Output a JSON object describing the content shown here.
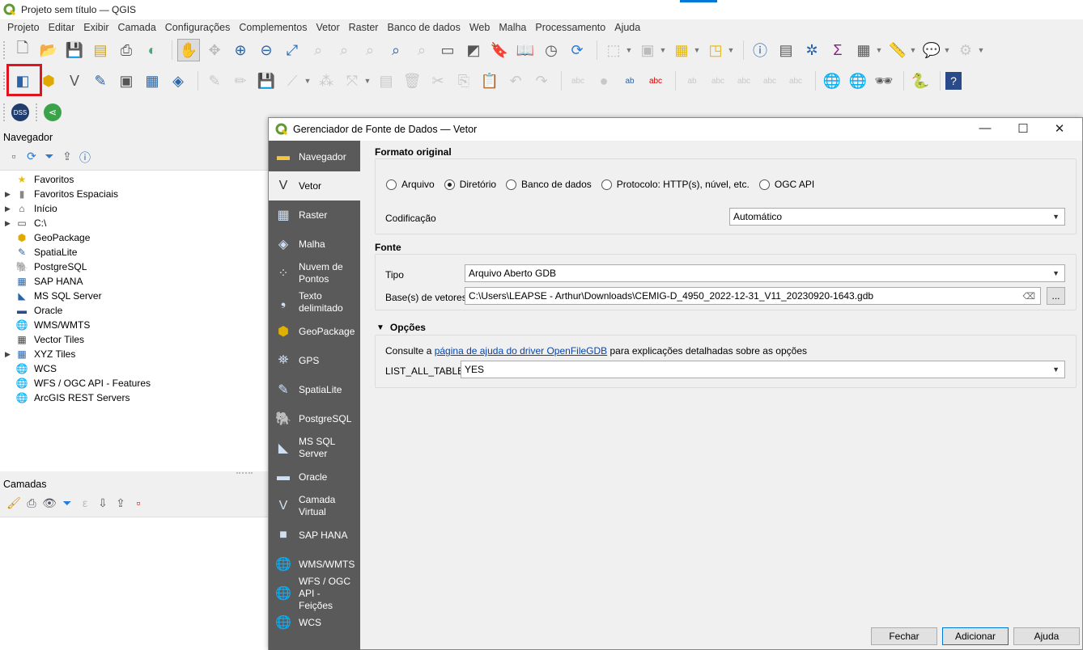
{
  "window": {
    "title": "Projeto sem título — QGIS"
  },
  "menu": [
    "Projeto",
    "Editar",
    "Exibir",
    "Camada",
    "Configurações",
    "Complementos",
    "Vetor",
    "Raster",
    "Banco de dados",
    "Web",
    "Malha",
    "Processamento",
    "Ajuda"
  ],
  "toolbar_row1_icons": [
    "new-project-icon",
    "open-project-icon",
    "save-project-icon",
    "new-print-layout-icon",
    "layout-manager-icon",
    "style-manager-icon",
    "pan-icon",
    "pan-to-selection-icon",
    "zoom-in-icon",
    "zoom-out-icon",
    "zoom-full-icon",
    "zoom-to-selection-icon",
    "zoom-to-layer-icon",
    "zoom-native-icon",
    "zoom-last-icon",
    "zoom-next-icon",
    "new-map-view-icon",
    "new-3d-view-icon",
    "bookmark-new-icon",
    "bookmarks-icon",
    "temporal-controller-icon",
    "refresh-icon",
    "select-features-icon",
    "deselect-icon",
    "select-by-value-icon",
    "identify-icon",
    "attribute-table-icon",
    "field-calculator-icon",
    "statistics-icon",
    "open-table-icon",
    "measure-icon",
    "annotation-icon",
    "processing-gear-icon"
  ],
  "toolbar_row2_icons": [
    "data-source-manager-icon",
    "new-geopackage-layer-icon",
    "new-shapefile-layer-icon",
    "new-spatialite-layer-icon",
    "new-temporary-layer-icon",
    "new-virtual-layer-icon",
    "new-mesh-layer-icon",
    "edit-pencil-icon",
    "toggle-edit-icon",
    "save-edits-icon",
    "digitize-line-icon",
    "vertex-tool-icon",
    "node-tool-icon",
    "modify-attributes-icon",
    "delete-selected-icon",
    "cut-icon",
    "copy-icon",
    "paste-icon",
    "undo-icon",
    "redo-icon",
    "label-tool-icon",
    "pin-labels-icon",
    "label-highlight-icon",
    "label-abc-icon",
    "label-move-icon",
    "label-show-icon",
    "label-rotate-icon",
    "label-change-icon",
    "label-reset-icon",
    "metasearch-icon",
    "metasearch-add-icon",
    "quick-osm-icon",
    "python-icon",
    "help-icon"
  ],
  "toolbar_row3_icons": [
    "dss-icon",
    "share-icon"
  ],
  "colors": {
    "highlight_border": "#e0141e",
    "sidebar_bg": "#5a5a5a",
    "link": "#0645ad",
    "accent": "#0078d7"
  },
  "navigator": {
    "title": "Navegador",
    "items": [
      {
        "label": "Favoritos",
        "icon": "star-icon",
        "expandable": false
      },
      {
        "label": "Favoritos Espaciais",
        "icon": "spatial-bookmarks-icon",
        "expandable": true
      },
      {
        "label": "Início",
        "icon": "home-icon",
        "expandable": true
      },
      {
        "label": "C:\\",
        "icon": "folder-icon",
        "expandable": true
      },
      {
        "label": "GeoPackage",
        "icon": "geopackage-icon",
        "expandable": false
      },
      {
        "label": "SpatiaLite",
        "icon": "spatialite-icon",
        "expandable": false
      },
      {
        "label": "PostgreSQL",
        "icon": "postgresql-icon",
        "expandable": false
      },
      {
        "label": "SAP HANA",
        "icon": "sap-hana-icon",
        "expandable": false
      },
      {
        "label": "MS SQL Server",
        "icon": "mssql-icon",
        "expandable": false
      },
      {
        "label": "Oracle",
        "icon": "oracle-icon",
        "expandable": false
      },
      {
        "label": "WMS/WMTS",
        "icon": "wms-globe-icon",
        "expandable": false
      },
      {
        "label": "Vector Tiles",
        "icon": "vector-tiles-icon",
        "expandable": false
      },
      {
        "label": "XYZ Tiles",
        "icon": "xyz-tiles-icon",
        "expandable": true
      },
      {
        "label": "WCS",
        "icon": "wcs-globe-icon",
        "expandable": false
      },
      {
        "label": "WFS / OGC API - Features",
        "icon": "wfs-globe-icon",
        "expandable": false
      },
      {
        "label": "ArcGIS REST Servers",
        "icon": "arcgis-icon",
        "expandable": false
      }
    ]
  },
  "layers": {
    "title": "Camadas"
  },
  "dialog": {
    "title": "Gerenciador de Fonte de Dados — Vetor",
    "sidebar": [
      {
        "label": "Navegador",
        "icon": "folder-icon"
      },
      {
        "label": "Vetor",
        "icon": "vector-icon"
      },
      {
        "label": "Raster",
        "icon": "raster-icon"
      },
      {
        "label": "Malha",
        "icon": "mesh-icon"
      },
      {
        "label": "Nuvem de Pontos",
        "icon": "point-cloud-icon"
      },
      {
        "label": "Texto delimitado",
        "icon": "delimited-text-icon"
      },
      {
        "label": "GeoPackage",
        "icon": "geopackage-icon"
      },
      {
        "label": "GPS",
        "icon": "gps-icon"
      },
      {
        "label": "SpatiaLite",
        "icon": "spatialite-icon"
      },
      {
        "label": "PostgreSQL",
        "icon": "postgresql-icon"
      },
      {
        "label": "MS SQL Server",
        "icon": "mssql-icon"
      },
      {
        "label": "Oracle",
        "icon": "oracle-icon"
      },
      {
        "label": "Camada Virtual",
        "icon": "virtual-layer-icon"
      },
      {
        "label": "SAP HANA",
        "icon": "sap-hana-icon"
      },
      {
        "label": "WMS/WMTS",
        "icon": "wms-globe-icon"
      },
      {
        "label": "WFS / OGC API - Feições",
        "icon": "wfs-globe-icon"
      },
      {
        "label": "WCS",
        "icon": "wcs-globe-icon"
      }
    ],
    "active_item": "Vetor",
    "source_type": {
      "title": "Formato original",
      "options": [
        "Arquivo",
        "Diretório",
        "Banco de dados",
        "Protocolo: HTTP(s), núvel, etc.",
        "OGC API"
      ],
      "selected": "Diretório",
      "encoding_label": "Codificação",
      "encoding_value": "Automático"
    },
    "source": {
      "title": "Fonte",
      "type_label": "Tipo",
      "type_value": "Arquivo Aberto GDB",
      "dataset_label": "Base(s) de vetores",
      "dataset_value": "C:\\Users\\LEAPSE - Arthur\\Downloads\\CEMIG-D_4950_2022-12-31_V11_20230920-1643.gdb",
      "browse_label": "..."
    },
    "options": {
      "title": "Opções",
      "help_prefix": "Consulte a ",
      "help_link": "página de ajuda do driver OpenFileGDB",
      "help_suffix": " para explicações detalhadas sobre as opções",
      "list_all_tables_label": "LIST_ALL_TABLES",
      "list_all_tables_value": "YES"
    },
    "buttons": {
      "close": "Fechar",
      "add": "Adicionar",
      "help": "Ajuda"
    }
  }
}
